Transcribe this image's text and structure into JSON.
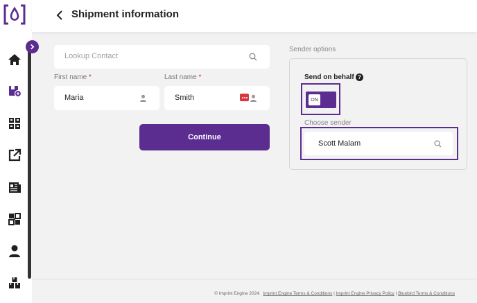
{
  "header": {
    "title": "Shipment information"
  },
  "form": {
    "lookup_placeholder": "Lookup Contact",
    "first_name_label": "First name",
    "first_name_value": "Maria",
    "last_name_label": "Last name",
    "last_name_value": "Smith",
    "required_mark": "*",
    "continue_label": "Continue"
  },
  "sender": {
    "section_title": "Sender options",
    "send_on_behalf_label": "Send on behalf",
    "help_glyph": "?",
    "toggle_state": "ON",
    "choose_sender_label": "Choose sender",
    "sender_value": "Scott Malam"
  },
  "sidebar": {
    "icons": [
      "home-icon",
      "shipment-icon",
      "products-icon",
      "external-link-icon",
      "catalog-icon",
      "integrations-icon",
      "user-icon",
      "inventory-icon"
    ]
  },
  "footer": {
    "copyright": "© Imprint Engine 2024.",
    "links": [
      "Imprint Engine Terms & Conditions",
      "Imprint Engine Privacy Policy",
      "Bluebird Terms & Conditions"
    ],
    "separator": "|"
  },
  "colors": {
    "brand": "#5b2d91",
    "background": "#f2f2f3",
    "badge": "#d9363e"
  }
}
